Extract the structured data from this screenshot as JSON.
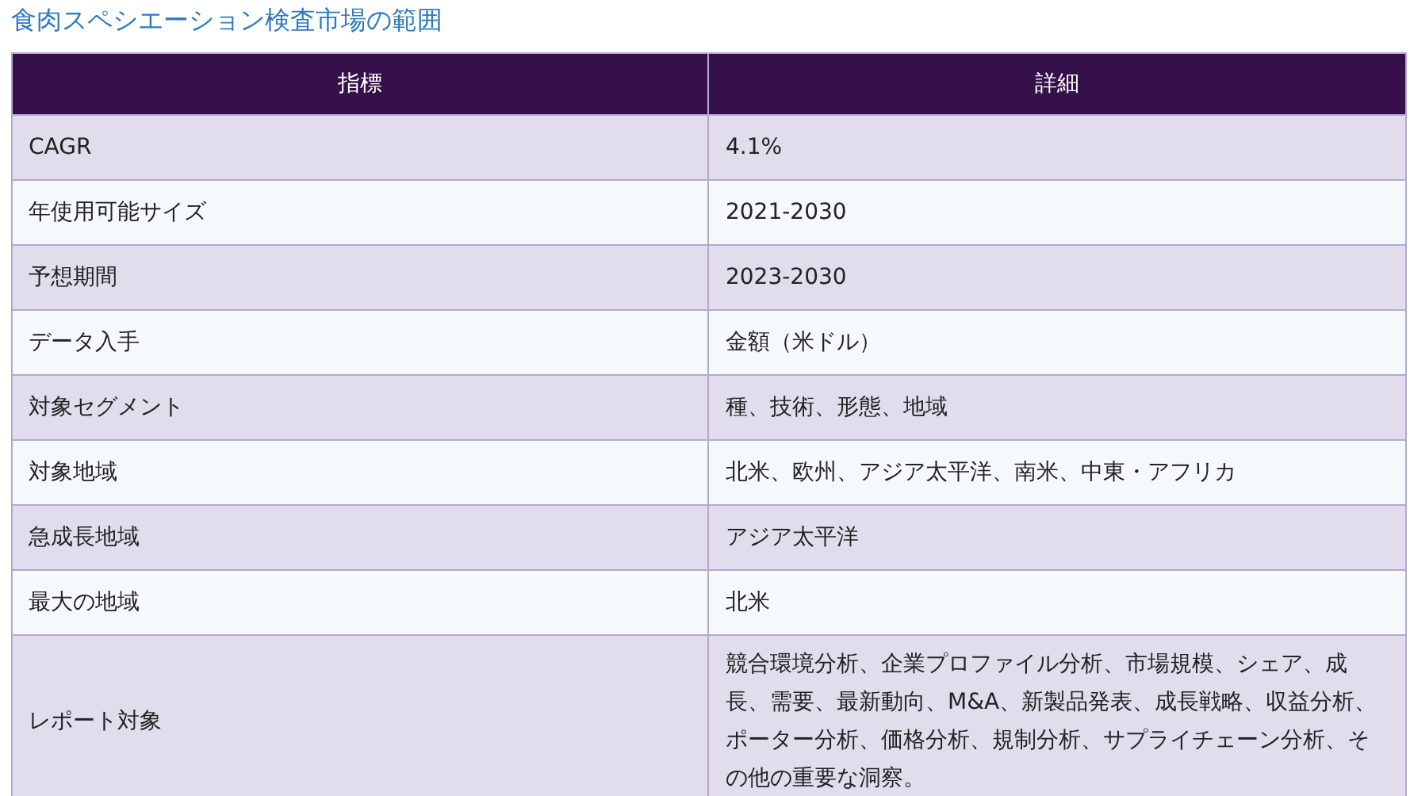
{
  "title": "食肉スペシエーション検査市場の範囲",
  "table": {
    "columns": [
      "指標",
      "詳細"
    ],
    "rows": [
      [
        "CAGR",
        "4.1%"
      ],
      [
        "年使用可能サイズ",
        "2021-2030"
      ],
      [
        "予想期間",
        "2023-2030"
      ],
      [
        "データ入手",
        "金額（米ドル）"
      ],
      [
        "対象セグメント",
        "種、技術、形態、地域"
      ],
      [
        "対象地域",
        "北米、欧州、アジア太平洋、南米、中東・アフリカ"
      ],
      [
        "急成長地域",
        "アジア太平洋"
      ],
      [
        "最大の地域",
        "北米"
      ],
      [
        "レポート対象",
        "競合環境分析、企業プロファイル分析、市場規模、シェア、成長、需要、最新動向、M&A、新製品発表、成長戦略、収益分析、ポーター分析、価格分析、規制分析、サプライチェーン分析、その他の重要な洞察。"
      ]
    ]
  }
}
